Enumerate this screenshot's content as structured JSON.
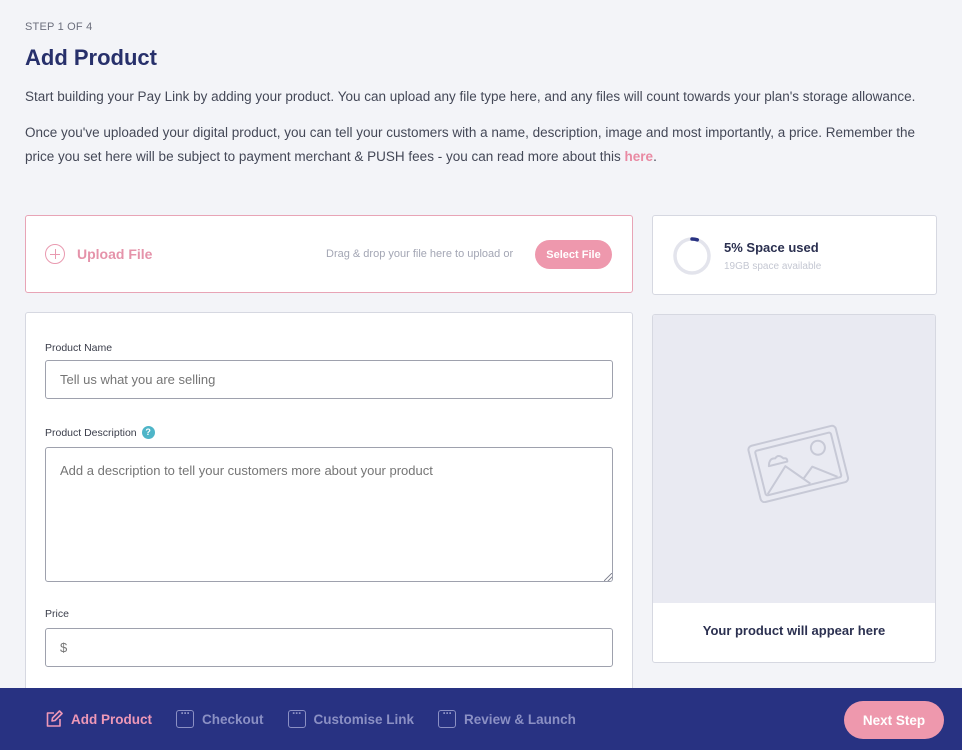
{
  "header": {
    "step_label": "STEP 1 OF 4",
    "title": "Add Product",
    "intro_1": "Start building your Pay Link by adding your product. You can upload any file type here, and any files will count towards your plan's storage allowance.",
    "intro_2_prefix": "Once you've uploaded your digital product, you can tell your customers with a name, description, image and most importantly, a price. Remember the price you set here will be subject to payment merchant & PUSH fees - you can read more about this ",
    "intro_2_link": "here",
    "intro_2_suffix": "."
  },
  "upload": {
    "label": "Upload File",
    "drag_text": "Drag & drop your file here to upload or",
    "select_button": "Select File"
  },
  "storage": {
    "title": "5% Space used",
    "subtitle": "19GB space available",
    "percent_used": 5
  },
  "form": {
    "name_label": "Product Name",
    "name_placeholder": "Tell us what you are selling",
    "name_value": "",
    "description_label": "Product Description",
    "description_help": "?",
    "description_placeholder": "Add a description to tell your customers more about your product",
    "description_value": "",
    "price_label": "Price",
    "price_placeholder": "$",
    "price_value": ""
  },
  "preview": {
    "text": "Your product will appear here"
  },
  "steps": [
    {
      "label": "Add Product",
      "icon": "edit-icon",
      "active": true
    },
    {
      "label": "Checkout",
      "icon": "dots-box-icon",
      "active": false
    },
    {
      "label": "Customise Link",
      "icon": "dots-box-icon",
      "active": false
    },
    {
      "label": "Review & Launch",
      "icon": "dots-box-icon",
      "active": false
    }
  ],
  "next_button": "Next Step",
  "colors": {
    "primary": "#283282",
    "accent": "#ee98ad",
    "help": "#4eb5c8",
    "background": "#f3f4f8"
  }
}
